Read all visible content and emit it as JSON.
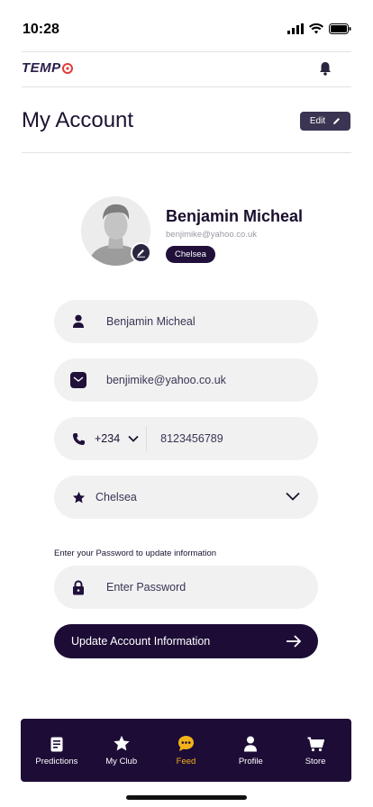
{
  "status_bar": {
    "time": "10:28"
  },
  "header": {
    "logo_text": "TEMP"
  },
  "page": {
    "title": "My Account",
    "edit_label": "Edit"
  },
  "profile": {
    "name": "Benjamin Micheal",
    "email": "benjimike@yahoo.co.uk",
    "club": "Chelsea"
  },
  "form": {
    "name_value": "Benjamin Micheal",
    "email_value": "benjimike@yahoo.co.uk",
    "phone_code": "+234",
    "phone_number": "8123456789",
    "club_value": "Chelsea",
    "password_hint": "Enter your Password to update information",
    "password_placeholder": "Enter Password",
    "submit_label": "Update Account Information"
  },
  "nav": {
    "items": [
      {
        "label": "Predictions",
        "icon": "predictions-icon"
      },
      {
        "label": "My Club",
        "icon": "star-icon"
      },
      {
        "label": "Feed",
        "icon": "chat-bubble-icon"
      },
      {
        "label": "Profile",
        "icon": "person-icon"
      },
      {
        "label": "Store",
        "icon": "cart-icon"
      }
    ],
    "active_index": 2
  },
  "colors": {
    "primary_dark": "#1d0c36",
    "accent_active": "#f2b21a",
    "field_bg": "#f1f1f2",
    "logo_red": "#e23b3b"
  }
}
